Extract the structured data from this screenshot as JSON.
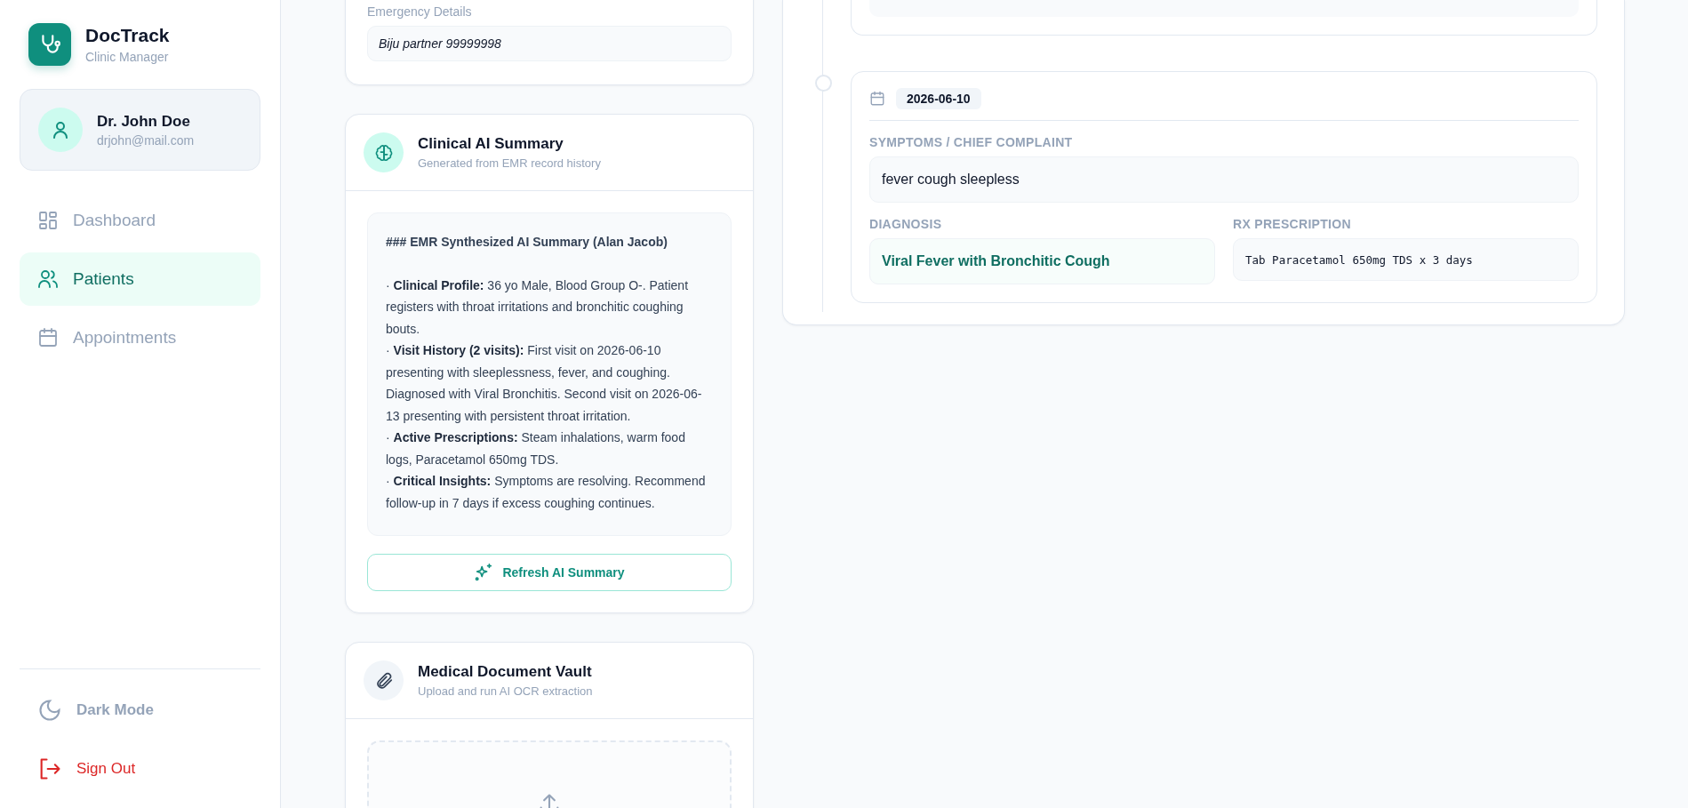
{
  "sidebar": {
    "brand": {
      "name": "DocTrack",
      "subtitle": "Clinic Manager"
    },
    "user": {
      "name": "Dr. John Doe",
      "email": "drjohn@mail.com"
    },
    "nav": [
      {
        "label": "Dashboard",
        "kind": "dashboard",
        "selected": false
      },
      {
        "label": "Patients",
        "kind": "patients",
        "selected": true
      },
      {
        "label": "Appointments",
        "kind": "appointments",
        "selected": false
      }
    ],
    "footer": [
      {
        "label": "Dark Mode",
        "kind": "theme"
      },
      {
        "label": "Sign Out",
        "kind": "signout"
      }
    ]
  },
  "emergency": {
    "label": "Emergency Details",
    "value": "Biju partner 99999998"
  },
  "ai_summary": {
    "title": "Clinical AI Summary",
    "subtitle": "Generated from EMR record history",
    "heading": "### EMR Synthesized AI Summary (Alan Jacob)",
    "bullets": [
      "· **Clinical Profile:** 36 yo Male, Blood Group O-. Patient registers with throat irritations and bronchitic coughing bouts.",
      "· **Visit History (2 visits):** First visit on 2026-06-10 presenting with sleeplessness, fever, and coughing. Diagnosed with Viral Bronchitis. Second visit on 2026-06-13 presenting with persistent throat irritation.",
      "· **Active Prescriptions:** Steam inhalations, warm food logs, Paracetamol 650mg TDS.",
      "· **Critical Insights:** Symptoms are resolving. Recommend follow-up in 7 days if excess coughing continues."
    ],
    "button": "Refresh AI Summary"
  },
  "document_vault": {
    "title": "Medical Document Vault",
    "subtitle": "Upload and run AI OCR extraction"
  },
  "visit": {
    "date": "2026-06-10",
    "symptoms_label": "SYMPTOMS / CHIEF COMPLAINT",
    "symptoms": "fever cough sleepless",
    "diagnosis_label": "DIAGNOSIS",
    "diagnosis": "Viral Fever with Bronchitic Cough",
    "rx_label": "RX PRESCRIPTION",
    "rx": "Tab Paracetamol 650mg TDS x 3 days"
  }
}
